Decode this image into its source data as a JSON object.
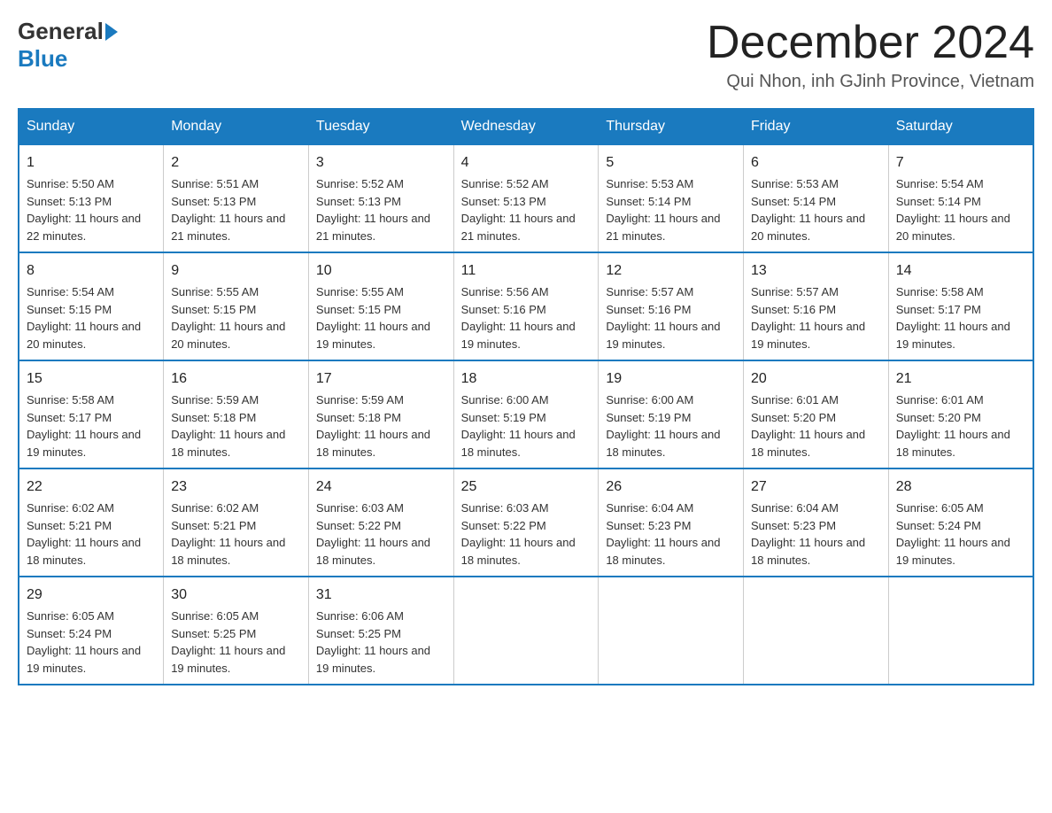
{
  "header": {
    "logo_general": "General",
    "logo_blue": "Blue",
    "month_title": "December 2024",
    "location": "Qui Nhon, inh GJinh Province, Vietnam"
  },
  "days_of_week": [
    "Sunday",
    "Monday",
    "Tuesday",
    "Wednesday",
    "Thursday",
    "Friday",
    "Saturday"
  ],
  "weeks": [
    [
      {
        "day": "1",
        "sunrise": "Sunrise: 5:50 AM",
        "sunset": "Sunset: 5:13 PM",
        "daylight": "Daylight: 11 hours and 22 minutes."
      },
      {
        "day": "2",
        "sunrise": "Sunrise: 5:51 AM",
        "sunset": "Sunset: 5:13 PM",
        "daylight": "Daylight: 11 hours and 21 minutes."
      },
      {
        "day": "3",
        "sunrise": "Sunrise: 5:52 AM",
        "sunset": "Sunset: 5:13 PM",
        "daylight": "Daylight: 11 hours and 21 minutes."
      },
      {
        "day": "4",
        "sunrise": "Sunrise: 5:52 AM",
        "sunset": "Sunset: 5:13 PM",
        "daylight": "Daylight: 11 hours and 21 minutes."
      },
      {
        "day": "5",
        "sunrise": "Sunrise: 5:53 AM",
        "sunset": "Sunset: 5:14 PM",
        "daylight": "Daylight: 11 hours and 21 minutes."
      },
      {
        "day": "6",
        "sunrise": "Sunrise: 5:53 AM",
        "sunset": "Sunset: 5:14 PM",
        "daylight": "Daylight: 11 hours and 20 minutes."
      },
      {
        "day": "7",
        "sunrise": "Sunrise: 5:54 AM",
        "sunset": "Sunset: 5:14 PM",
        "daylight": "Daylight: 11 hours and 20 minutes."
      }
    ],
    [
      {
        "day": "8",
        "sunrise": "Sunrise: 5:54 AM",
        "sunset": "Sunset: 5:15 PM",
        "daylight": "Daylight: 11 hours and 20 minutes."
      },
      {
        "day": "9",
        "sunrise": "Sunrise: 5:55 AM",
        "sunset": "Sunset: 5:15 PM",
        "daylight": "Daylight: 11 hours and 20 minutes."
      },
      {
        "day": "10",
        "sunrise": "Sunrise: 5:55 AM",
        "sunset": "Sunset: 5:15 PM",
        "daylight": "Daylight: 11 hours and 19 minutes."
      },
      {
        "day": "11",
        "sunrise": "Sunrise: 5:56 AM",
        "sunset": "Sunset: 5:16 PM",
        "daylight": "Daylight: 11 hours and 19 minutes."
      },
      {
        "day": "12",
        "sunrise": "Sunrise: 5:57 AM",
        "sunset": "Sunset: 5:16 PM",
        "daylight": "Daylight: 11 hours and 19 minutes."
      },
      {
        "day": "13",
        "sunrise": "Sunrise: 5:57 AM",
        "sunset": "Sunset: 5:16 PM",
        "daylight": "Daylight: 11 hours and 19 minutes."
      },
      {
        "day": "14",
        "sunrise": "Sunrise: 5:58 AM",
        "sunset": "Sunset: 5:17 PM",
        "daylight": "Daylight: 11 hours and 19 minutes."
      }
    ],
    [
      {
        "day": "15",
        "sunrise": "Sunrise: 5:58 AM",
        "sunset": "Sunset: 5:17 PM",
        "daylight": "Daylight: 11 hours and 19 minutes."
      },
      {
        "day": "16",
        "sunrise": "Sunrise: 5:59 AM",
        "sunset": "Sunset: 5:18 PM",
        "daylight": "Daylight: 11 hours and 18 minutes."
      },
      {
        "day": "17",
        "sunrise": "Sunrise: 5:59 AM",
        "sunset": "Sunset: 5:18 PM",
        "daylight": "Daylight: 11 hours and 18 minutes."
      },
      {
        "day": "18",
        "sunrise": "Sunrise: 6:00 AM",
        "sunset": "Sunset: 5:19 PM",
        "daylight": "Daylight: 11 hours and 18 minutes."
      },
      {
        "day": "19",
        "sunrise": "Sunrise: 6:00 AM",
        "sunset": "Sunset: 5:19 PM",
        "daylight": "Daylight: 11 hours and 18 minutes."
      },
      {
        "day": "20",
        "sunrise": "Sunrise: 6:01 AM",
        "sunset": "Sunset: 5:20 PM",
        "daylight": "Daylight: 11 hours and 18 minutes."
      },
      {
        "day": "21",
        "sunrise": "Sunrise: 6:01 AM",
        "sunset": "Sunset: 5:20 PM",
        "daylight": "Daylight: 11 hours and 18 minutes."
      }
    ],
    [
      {
        "day": "22",
        "sunrise": "Sunrise: 6:02 AM",
        "sunset": "Sunset: 5:21 PM",
        "daylight": "Daylight: 11 hours and 18 minutes."
      },
      {
        "day": "23",
        "sunrise": "Sunrise: 6:02 AM",
        "sunset": "Sunset: 5:21 PM",
        "daylight": "Daylight: 11 hours and 18 minutes."
      },
      {
        "day": "24",
        "sunrise": "Sunrise: 6:03 AM",
        "sunset": "Sunset: 5:22 PM",
        "daylight": "Daylight: 11 hours and 18 minutes."
      },
      {
        "day": "25",
        "sunrise": "Sunrise: 6:03 AM",
        "sunset": "Sunset: 5:22 PM",
        "daylight": "Daylight: 11 hours and 18 minutes."
      },
      {
        "day": "26",
        "sunrise": "Sunrise: 6:04 AM",
        "sunset": "Sunset: 5:23 PM",
        "daylight": "Daylight: 11 hours and 18 minutes."
      },
      {
        "day": "27",
        "sunrise": "Sunrise: 6:04 AM",
        "sunset": "Sunset: 5:23 PM",
        "daylight": "Daylight: 11 hours and 18 minutes."
      },
      {
        "day": "28",
        "sunrise": "Sunrise: 6:05 AM",
        "sunset": "Sunset: 5:24 PM",
        "daylight": "Daylight: 11 hours and 19 minutes."
      }
    ],
    [
      {
        "day": "29",
        "sunrise": "Sunrise: 6:05 AM",
        "sunset": "Sunset: 5:24 PM",
        "daylight": "Daylight: 11 hours and 19 minutes."
      },
      {
        "day": "30",
        "sunrise": "Sunrise: 6:05 AM",
        "sunset": "Sunset: 5:25 PM",
        "daylight": "Daylight: 11 hours and 19 minutes."
      },
      {
        "day": "31",
        "sunrise": "Sunrise: 6:06 AM",
        "sunset": "Sunset: 5:25 PM",
        "daylight": "Daylight: 11 hours and 19 minutes."
      },
      {
        "day": "",
        "sunrise": "",
        "sunset": "",
        "daylight": ""
      },
      {
        "day": "",
        "sunrise": "",
        "sunset": "",
        "daylight": ""
      },
      {
        "day": "",
        "sunrise": "",
        "sunset": "",
        "daylight": ""
      },
      {
        "day": "",
        "sunrise": "",
        "sunset": "",
        "daylight": ""
      }
    ]
  ]
}
